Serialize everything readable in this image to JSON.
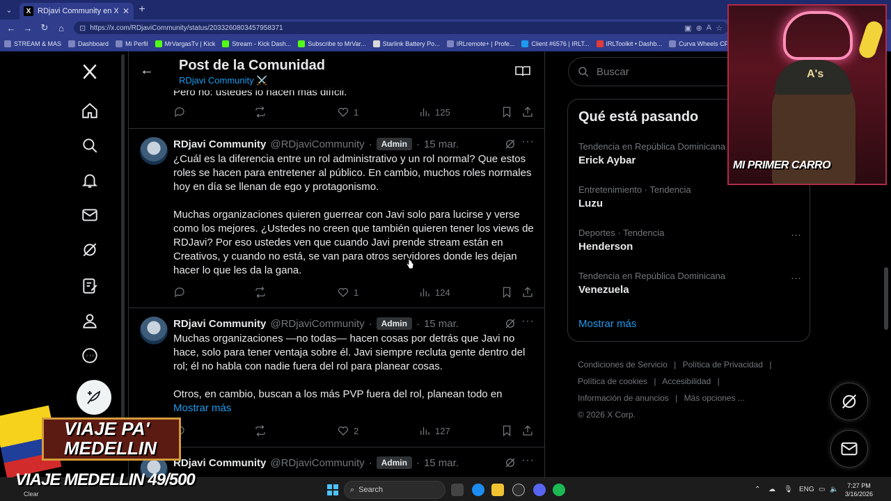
{
  "browser": {
    "tab_title": "RDjavi Community en X: \"La gente",
    "tab_favicon": "X",
    "url": "https://x.com/RDjaviCommunity/status/2033260803457958371",
    "bookmarks": [
      "STREAM & MAS",
      "Dashboard",
      "Mi Perfil",
      "MrVargasTv | Kick",
      "Stream - Kick Dash...",
      "Subscribe to MrVar...",
      "Starlink Battery Po...",
      "IRLremote+ | Profe...",
      "Client #6576 | IRLT...",
      "IRLToolkit • Dashb...",
      "Curva Wheels CFF7€"
    ]
  },
  "header": {
    "title": "Post de la Comunidad",
    "subtitle": "RDjavi Community ⚔️"
  },
  "tweets": [
    {
      "body_partial": "Pero no: ustedes lo hacen más difícil.",
      "replies": "",
      "retweets": "",
      "likes": "1",
      "views": "125"
    },
    {
      "name": "RDjavi Community",
      "handle": "@RDjaviCommunity",
      "badge": "Admin",
      "sep": "·",
      "date": "15 mar.",
      "body": "¿Cuál es la diferencia entre un rol administrativo y un rol normal? Que estos roles se hacen para entretener al público. En cambio, muchos roles normales hoy en día se llenan de ego y protagonismo.\n\nMuchas organizaciones quieren guerrear con Javi solo para lucirse y verse como los mejores. ¿Ustedes no creen que también quieren tener los views de RDJavi? Por eso ustedes ven que cuando Javi prende stream están en Creativos, y cuando no está, se van para otros servidores donde les dejan hacer lo que les da la gana.",
      "likes": "1",
      "views": "124"
    },
    {
      "name": "RDjavi Community",
      "handle": "@RDjaviCommunity",
      "badge": "Admin",
      "sep": "·",
      "date": "15 mar.",
      "body": "Muchas organizaciones —no todas— hacen cosas por detrás que Javi no hace, solo para tener ventaja sobre él. Javi siempre recluta gente dentro del rol; él no habla con nadie fuera del rol para planear cosas.\n\nOtros, en cambio, buscan a los más PVP fuera del rol, planean todo en",
      "show_more": "Mostrar más",
      "likes": "2",
      "views": "127"
    },
    {
      "name": "RDjavi Community",
      "handle": "@RDjaviCommunity",
      "badge": "Admin",
      "sep": "·",
      "date": "15 mar."
    }
  ],
  "search": {
    "placeholder": "Buscar"
  },
  "trends": {
    "title": "Qué está pasando",
    "items": [
      {
        "context": "Tendencia en República Dominicana",
        "name": "Erick Aybar"
      },
      {
        "context": "Entretenimiento · Tendencia",
        "name": "Luzu"
      },
      {
        "context": "Deportes · Tendencia",
        "name": "Henderson"
      },
      {
        "context": "Tendencia en República Dominicana",
        "name": "Venezuela"
      }
    ],
    "more": "Mostrar más"
  },
  "footer": {
    "links": [
      "Condiciones de Servicio",
      "|",
      "Política de Privacidad",
      "|",
      "Política de cookies",
      "|",
      "Accesibilidad",
      "|",
      "Información de anuncios",
      "|",
      "Más opciones ..."
    ],
    "copyright": "© 2026 X Corp."
  },
  "overlay": {
    "webcam_label": "MI PRIMER CARRO",
    "cap_logo": "A's",
    "banner_title": "VIAJE PA' MEDELLIN",
    "count": "VIAJE MEDELLIN 49/500"
  },
  "taskbar": {
    "weather": "Clear",
    "search": "Search",
    "lang": "ENG",
    "time": "7:27 PM",
    "date": "3/16/2026"
  },
  "colors": {
    "accent": "#1d9bf0",
    "border": "#2f3336",
    "muted": "#71767b"
  }
}
